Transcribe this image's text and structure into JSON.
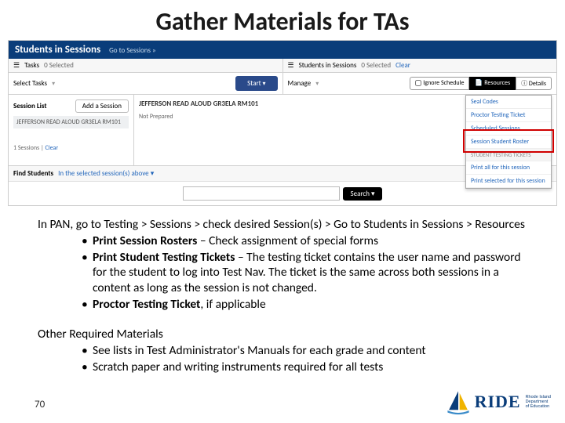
{
  "slide": {
    "title": "Gather Materials for TAs",
    "page_number": "70"
  },
  "app": {
    "header_title": "Students in Sessions",
    "header_goto": "Go to Sessions »",
    "tasks_tab": "Tasks",
    "tasks_selected": "0 Selected",
    "students_tab": "Students in Sessions",
    "students_selected": "0 Selected",
    "clear": "Clear",
    "select_tasks": "Select Tasks",
    "start_btn": "Start",
    "manage": "Manage",
    "ignore_schedule": "Ignore Schedule",
    "resources_btn": "Resources",
    "details_btn": "Details",
    "session_list_title": "Session List",
    "add_session": "Add a Session",
    "session_name": "JEFFERSON READ ALOUD GR3ELA RM101",
    "content_title": "JEFFERSON READ ALOUD GR3ELA RM101",
    "not_prepared": "Not Prepared",
    "sessions_count": "1 Sessions |",
    "sessions_clear": "Clear",
    "find_label": "Find Students",
    "find_scope": "In the selected session(s) above",
    "search_btn": "Search",
    "menu": {
      "seal_codes": "Seal Codes",
      "proctor_ticket": "Proctor Testing Ticket",
      "scheduled": "Scheduled Sessions",
      "roster": "Session Student Roster",
      "section": "STUDENT TESTING TICKETS",
      "print_all": "Print all for this session",
      "print_sel": "Print selected for this session"
    }
  },
  "instructions": {
    "intro": "In PAN, go to Testing > Sessions > check desired Session(s) > Go to Students in Sessions > Resources",
    "b1_bold": "Print Session Rosters",
    "b1_rest": " – Check assignment of special forms",
    "b2_bold": "Print Student Testing Tickets",
    "b2_rest": " – The testing ticket contains the user name and password for the student to log into Test Nav. The ticket is the same across both sessions in a content as long as the session is not changed.",
    "b3_bold": "Proctor Testing Ticket",
    "b3_rest": ", if applicable",
    "other_title": "Other Required Materials",
    "ob1": "See lists in Test Administrator's Manuals for each grade and content",
    "ob2": "Scratch paper and writing instruments required for all tests"
  },
  "logo": {
    "text": "RIDE",
    "sub1": "Rhode Island",
    "sub2": "Department",
    "sub3": "of Education"
  }
}
